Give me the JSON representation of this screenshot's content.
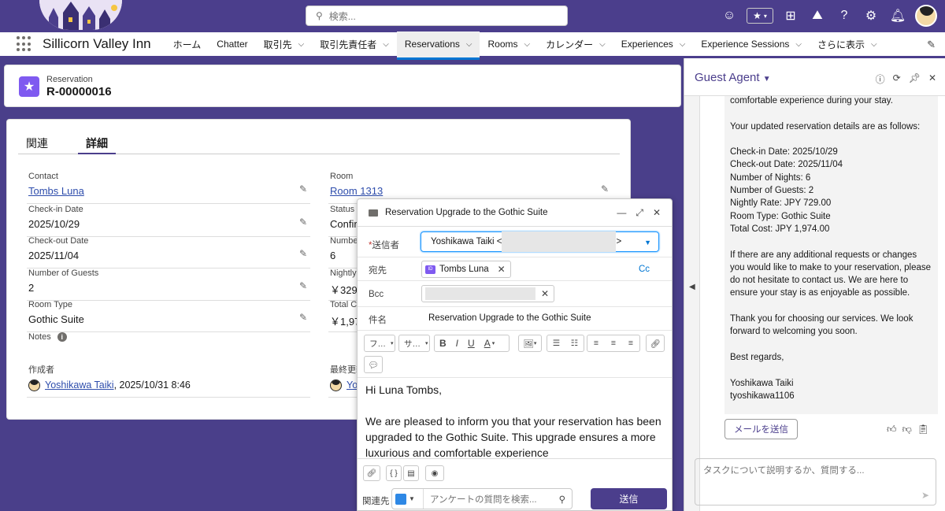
{
  "header": {
    "search_placeholder": "検索...",
    "icons": [
      "astro-icon",
      "favorites-star-icon",
      "add-icon",
      "trailhead-icon",
      "help-icon",
      "setup-gear-icon",
      "bell-icon",
      "user-avatar"
    ]
  },
  "nav": {
    "app_name": "Sillicorn Valley Inn",
    "items": [
      {
        "label": "ホーム",
        "has_menu": false
      },
      {
        "label": "Chatter",
        "has_menu": false
      },
      {
        "label": "取引先",
        "has_menu": true
      },
      {
        "label": "取引先責任者",
        "has_menu": true
      },
      {
        "label": "Reservations",
        "has_menu": true,
        "active": true
      },
      {
        "label": "Rooms",
        "has_menu": true
      },
      {
        "label": "カレンダー",
        "has_menu": true
      },
      {
        "label": "Experiences",
        "has_menu": true
      },
      {
        "label": "Experience Sessions",
        "has_menu": true
      },
      {
        "label": "さらに表示",
        "has_menu": true
      }
    ]
  },
  "record": {
    "object_label": "Reservation",
    "name": "R-00000016"
  },
  "detail": {
    "tabs": [
      "関連",
      "詳細"
    ],
    "left_fields": [
      {
        "label": "Contact",
        "value": "Tombs Luna"
      },
      {
        "label": "Check-in Date",
        "value": "2025/10/29"
      },
      {
        "label": "Check-out Date",
        "value": "2025/11/04"
      },
      {
        "label": "Number of Guests",
        "value": "2"
      },
      {
        "label": "Room Type",
        "value": "Gothic Suite"
      },
      {
        "label": "Notes",
        "value": ""
      }
    ],
    "right_fields": [
      {
        "label": "Room",
        "value": "Room 1313"
      },
      {
        "label": "Status",
        "value": "Confir"
      },
      {
        "label": "Numbe",
        "value": "6"
      },
      {
        "label": "Nightly",
        "value": "￥329."
      },
      {
        "label": "Total Co",
        "value": "￥1,974"
      }
    ],
    "created_by_label": "作成者",
    "created_by_name": "Yoshikawa Taiki",
    "created_by_date": ", 2025/10/31 8:46",
    "modified_by_label": "最終更新",
    "modified_by_name": "Yo"
  },
  "composer": {
    "title": "Reservation Upgrade to the Gothic Suite",
    "from_label": "送信者",
    "from_value": "Yoshikawa Taiki <",
    "from_suffix": ">",
    "to_label": "宛先",
    "to_recipient": "Tombs Luna",
    "cc_label": "Cc",
    "bcc_label": "Bcc",
    "subject_label": "件名",
    "subject_value": "Reservation Upgrade to the Gothic Suite",
    "toolbar": {
      "font": "フ…",
      "size": "サ…",
      "bold": "B",
      "italic": "I",
      "underline": "U",
      "color": "A"
    },
    "body": [
      "Hi Luna Tombs,",
      "We are pleased to inform you that your reservation has been upgraded to the Gothic Suite. This upgrade ensures a more luxurious and comfortable experience"
    ],
    "related_label": "関連先",
    "related_placeholder": "アンケートの質問を検索...",
    "send_label": "送信"
  },
  "agent": {
    "title": "Guest Agent",
    "message_lines": [
      "comfortable experience during your stay.",
      "Your updated reservation details are as follows:",
      "Check-in Date: 2025/10/29\nCheck-out Date: 2025/11/04\nNumber of Nights: 6\nNumber of Guests: 2\nNightly Rate: JPY 729.00\nRoom Type: Gothic Suite\nTotal Cost: JPY 1,974.00",
      "If there are any additional requests or changes\nyou would like to make to your reservation, please\ndo not hesitate to contact us. We are here to\nensure your stay is as enjoyable as possible.",
      "Thank you for choosing our services. We look\nforward to welcoming you soon.",
      "Best regards,",
      "Yoshikawa Taiki\ntyoshikawa1106"
    ],
    "send_mail_label": "メールを送信",
    "input_placeholder": "タスクについて説明するか、質問する..."
  }
}
